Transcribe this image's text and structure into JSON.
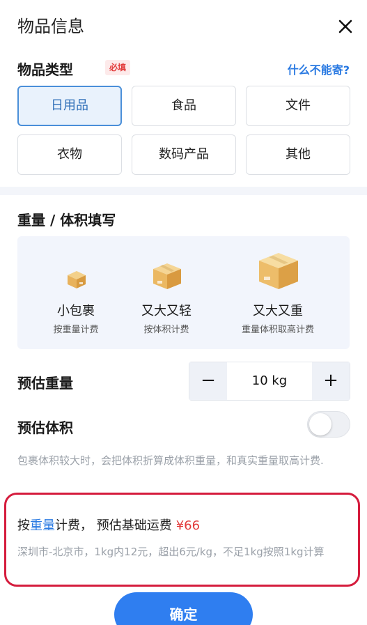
{
  "header": {
    "title": "物品信息",
    "close_icon": "close-icon"
  },
  "item_type": {
    "label": "物品类型",
    "required_badge": "必填",
    "help_link": "什么不能寄?",
    "options": [
      "日用品",
      "食品",
      "文件",
      "衣物",
      "数码产品",
      "其他"
    ],
    "selected": "日用品"
  },
  "weight_volume": {
    "title": "重量 / 体积填写",
    "packages": [
      {
        "name": "小包裹",
        "desc": "按重量计费",
        "icon": "small-box-icon"
      },
      {
        "name": "又大又轻",
        "desc": "按体积计费",
        "icon": "medium-box-icon"
      },
      {
        "name": "又大又重",
        "desc": "重量体积取高计费",
        "icon": "large-box-icon"
      }
    ]
  },
  "estimated_weight": {
    "label": "预估重量",
    "value": "10 kg",
    "minus": "−",
    "plus": "+"
  },
  "estimated_volume": {
    "label": "预估体积",
    "enabled": false
  },
  "volume_note": "包裹体积较大时，会把体积折算成体积重量，和真实重量取高计费.",
  "estimate": {
    "prefix": "按",
    "mode": "重量",
    "middle": "计费，  预估基础运费",
    "price": "¥66",
    "detail": "深圳市-北京市，1kg内12元，超出6元/kg，不足1kg按照1kg计算"
  },
  "confirm_label": "确定",
  "colors": {
    "accent": "#2f7ef0",
    "price": "#e23b3b",
    "highlight_border": "#d51c3d",
    "link": "#2a7ae2"
  }
}
